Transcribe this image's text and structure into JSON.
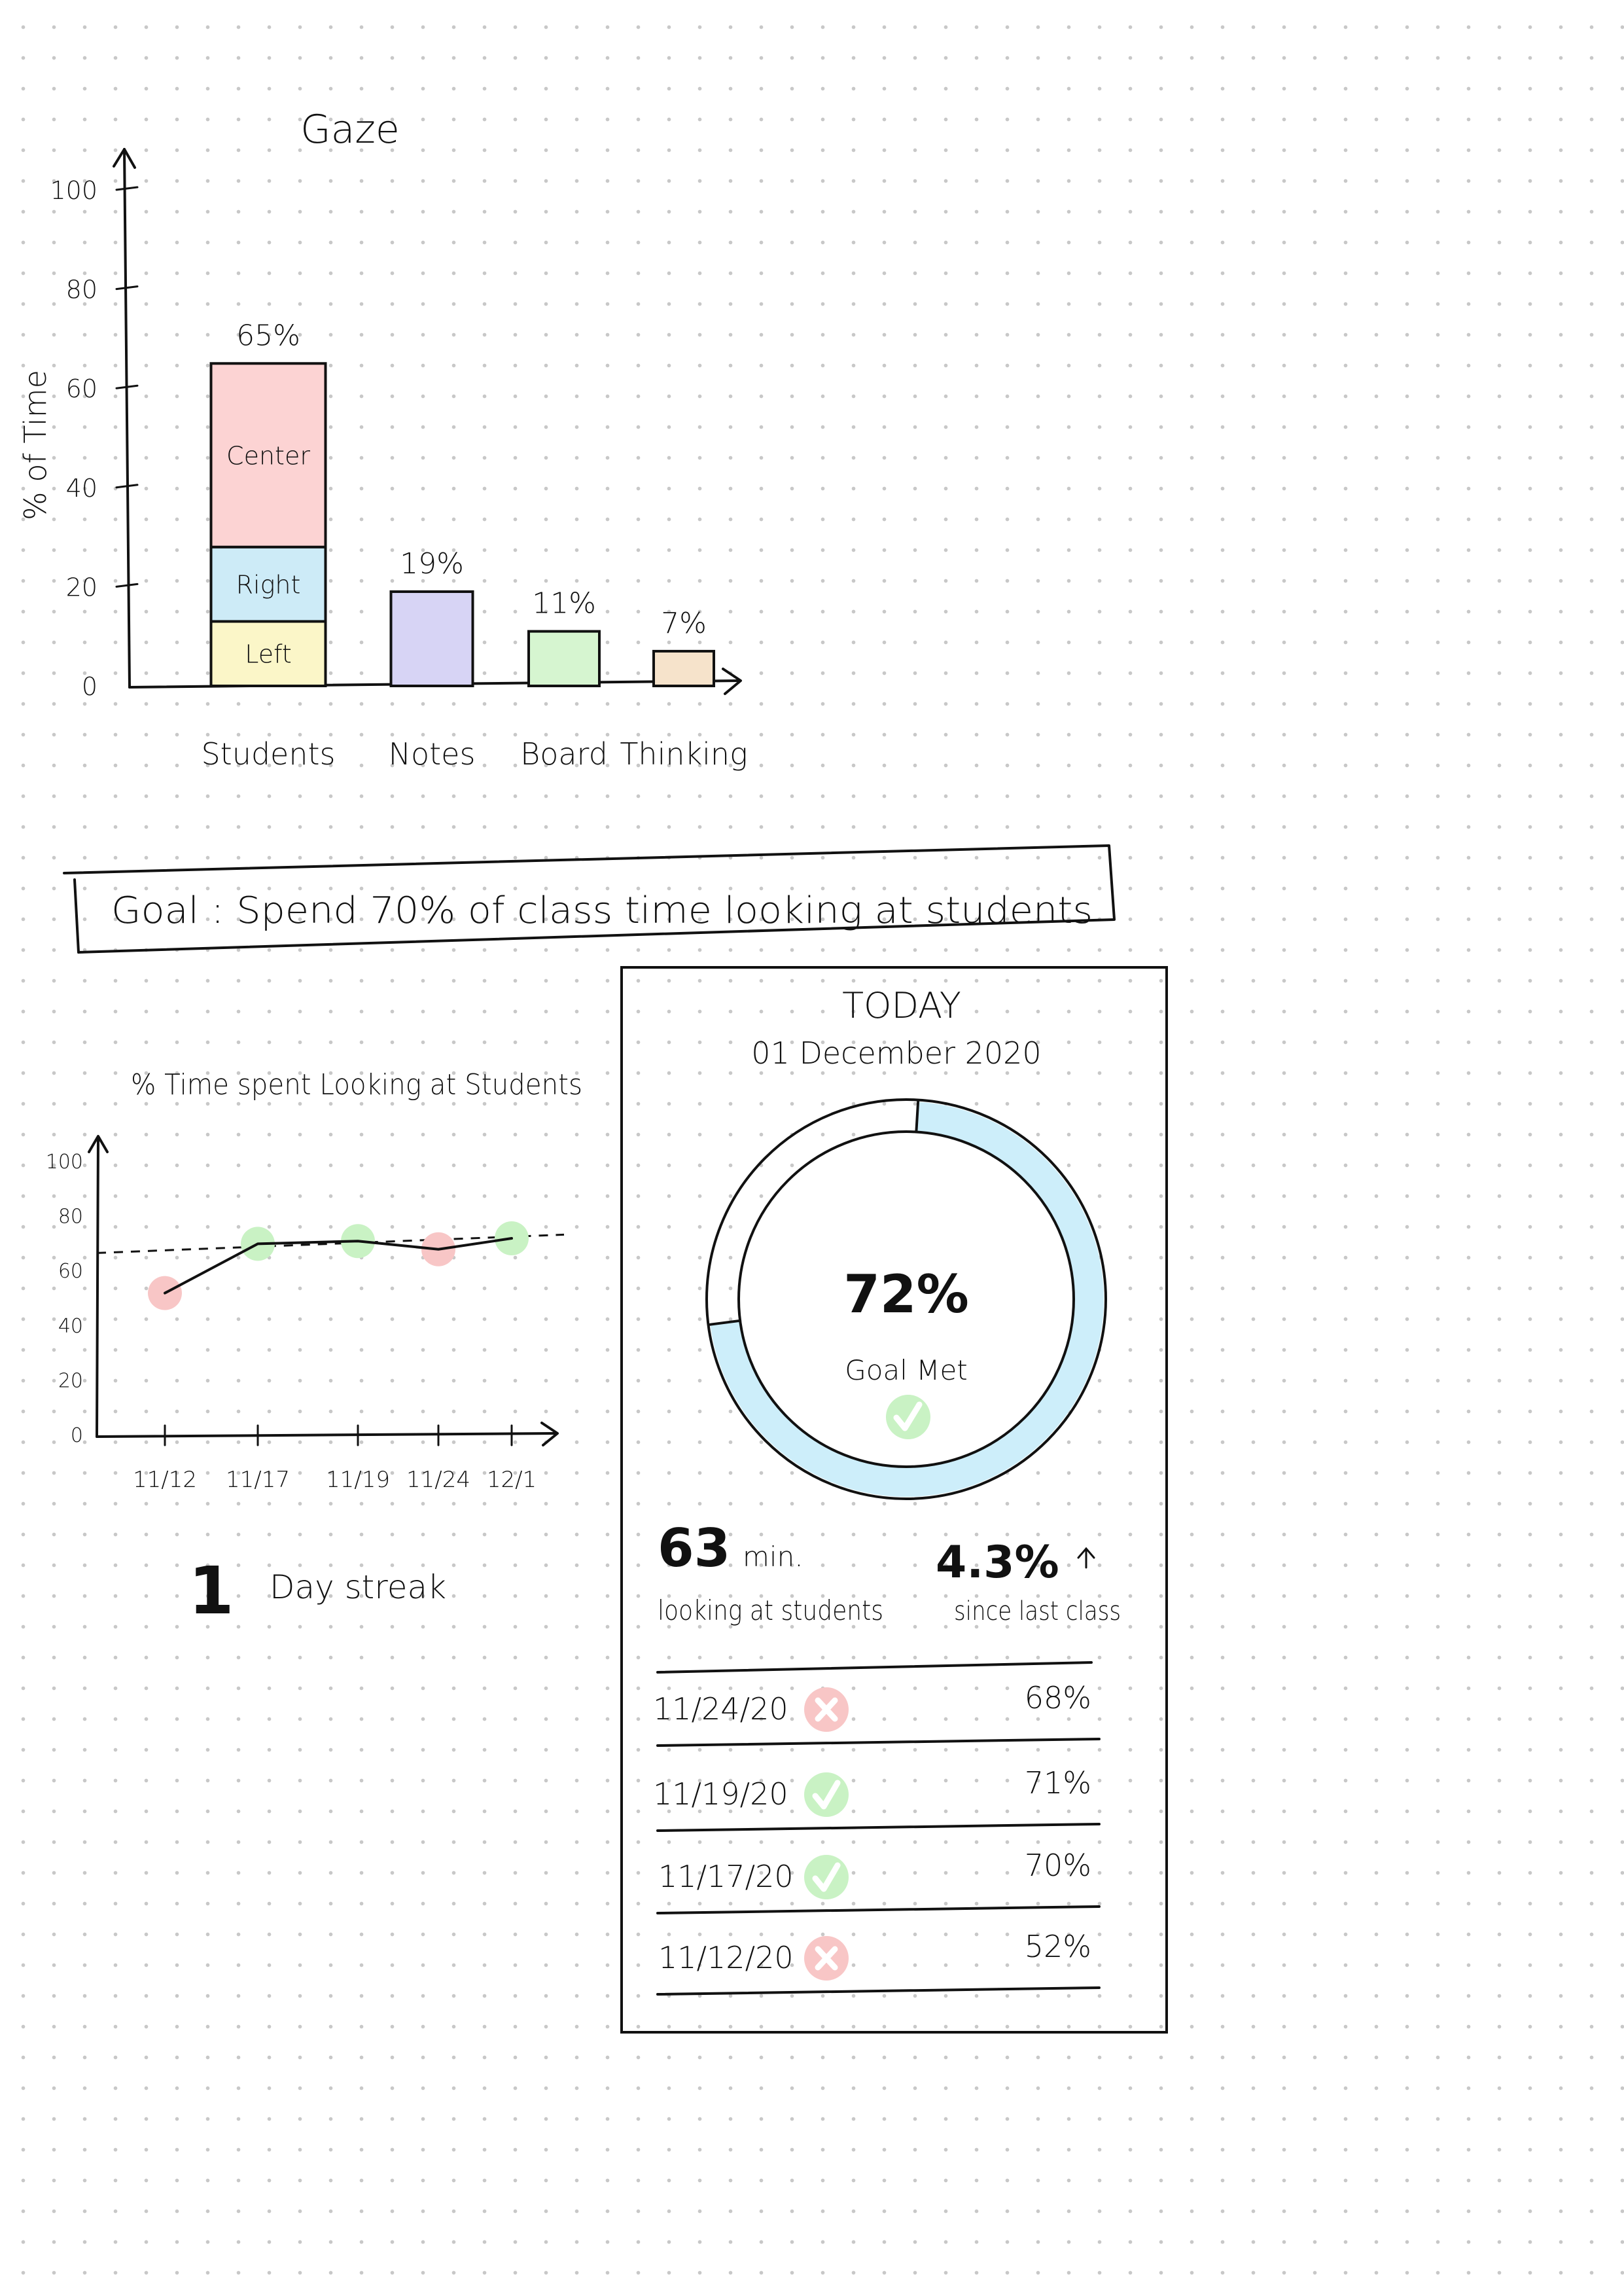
{
  "chart_data": [
    {
      "type": "bar",
      "title": "Gaze",
      "ylabel": "% of Time",
      "xlabel": "",
      "ylim": [
        0,
        100
      ],
      "yticks": [
        "0",
        "20",
        "40",
        "60",
        "80",
        "100"
      ],
      "categories": [
        "Students",
        "Notes",
        "Board",
        "Thinking"
      ],
      "values": [
        65,
        19,
        11,
        7
      ],
      "value_labels": [
        "65%",
        "19%",
        "11%",
        "7%"
      ],
      "stacks": [
        {
          "name": "Left",
          "value": 13,
          "color": "#fbf6c8"
        },
        {
          "name": "Right",
          "value": 15,
          "color": "#cdebf7"
        },
        {
          "name": "Center",
          "value": 37,
          "color": "#fcd3d3"
        }
      ],
      "bar_colors": [
        "",
        "#d7d4f5",
        "#d6f5d0",
        "#f6e3cb"
      ],
      "grid": false
    },
    {
      "type": "line",
      "title": "% Time spent Looking at Students",
      "ylim": [
        0,
        100
      ],
      "yticks": [
        "0",
        "20",
        "40",
        "60",
        "80",
        "100"
      ],
      "x": [
        "11/12",
        "11/17",
        "11/19",
        "11/24",
        "12/1"
      ],
      "values": [
        52,
        70,
        71,
        68,
        72
      ],
      "goal_line": 70,
      "marker_status": [
        "miss",
        "met",
        "met",
        "miss",
        "met"
      ],
      "colors": {
        "met": "#c9f2c4",
        "miss": "#f8c6c6"
      },
      "grid": false
    },
    {
      "type": "pie",
      "title": "TODAY",
      "values": [
        72,
        28
      ],
      "colors": [
        "#cdeefa",
        "#ffffff"
      ]
    }
  ],
  "goal_banner": "Goal : Spend 70% of class time looking at students",
  "streak": {
    "number": "1",
    "label": "Day streak"
  },
  "today": {
    "heading": "TODAY",
    "date": "01 December 2020",
    "percent": "72%",
    "status": "Goal Met",
    "status_icon": "check-icon",
    "minutes_value": "63",
    "minutes_unit": "min.",
    "minutes_label": "looking at students",
    "change_value": "4.3%",
    "change_icon": "arrow-up-icon",
    "change_label": "since last class"
  },
  "history": [
    {
      "date": "11/24/20",
      "status": "miss",
      "icon": "x-icon",
      "percent": "68%"
    },
    {
      "date": "11/19/20",
      "status": "met",
      "icon": "check-icon",
      "percent": "71%"
    },
    {
      "date": "11/17/20",
      "status": "met",
      "icon": "check-icon",
      "percent": "70%"
    },
    {
      "date": "11/12/20",
      "status": "miss",
      "icon": "x-icon",
      "percent": "52%"
    }
  ],
  "colors": {
    "met": "#c9f2c4",
    "miss": "#f8c6c6",
    "ring": "#cdeefa"
  }
}
